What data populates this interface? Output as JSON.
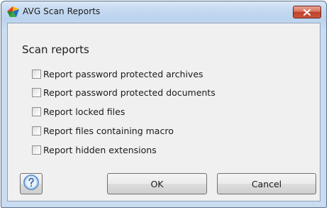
{
  "window": {
    "title": "AVG Scan Reports",
    "close_icon": "close-icon",
    "app_icon": "avg-logo-icon"
  },
  "dialog": {
    "heading": "Scan reports",
    "options": [
      {
        "label": "Report password protected archives",
        "checked": false
      },
      {
        "label": "Report password protected documents",
        "checked": false
      },
      {
        "label": "Report locked files",
        "checked": false
      },
      {
        "label": "Report files containing macro",
        "checked": false
      },
      {
        "label": "Report hidden extensions",
        "checked": false
      }
    ]
  },
  "buttons": {
    "help_icon": "help-icon",
    "ok_label": "OK",
    "cancel_label": "Cancel"
  },
  "colors": {
    "close_button": "#c9553a",
    "help_icon": "#4a86c8"
  }
}
